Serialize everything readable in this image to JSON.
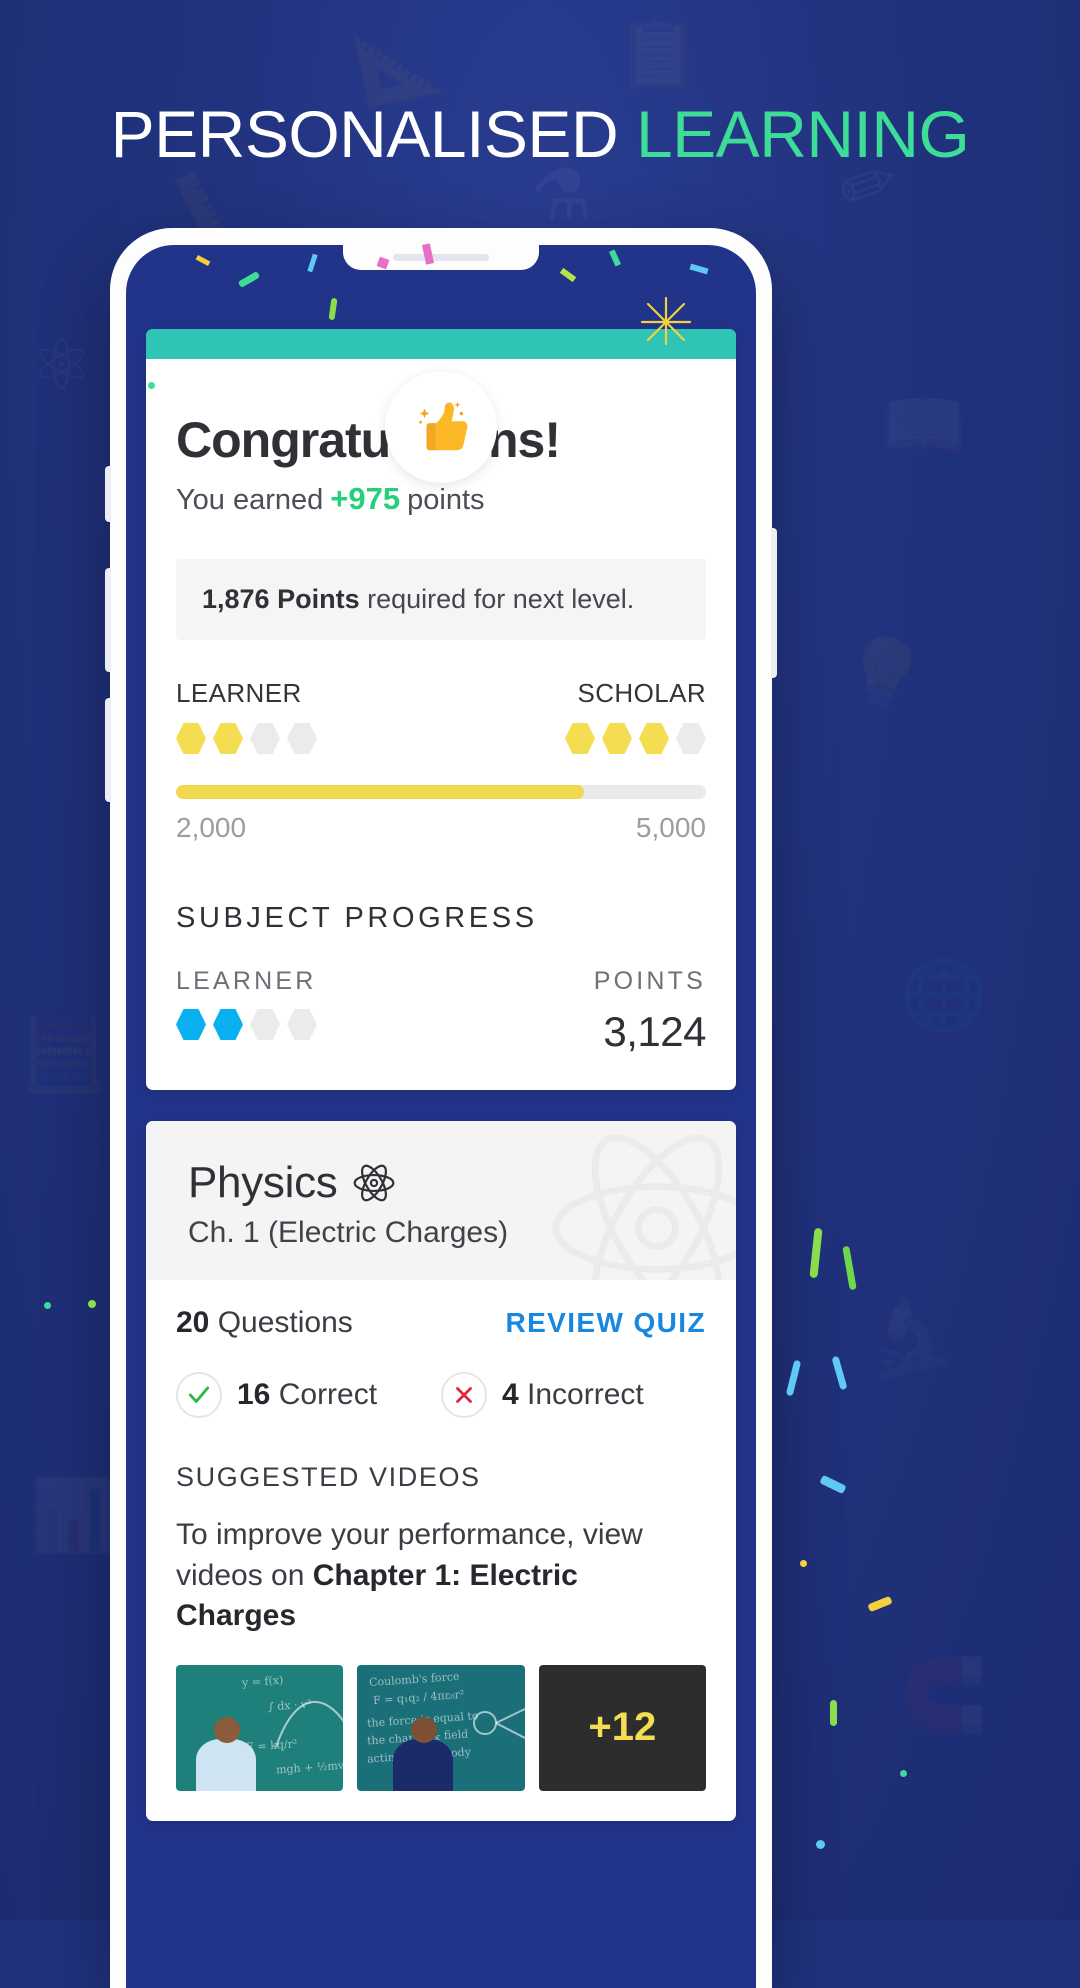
{
  "headline": {
    "word1": "PERSONALISED",
    "word2": "LEARNING",
    "color1": "#ffffff",
    "color2": "#3ddc97"
  },
  "theme": {
    "background": "#21327e",
    "teal_bar": "#2ec4b6",
    "accent_green": "#25d07d",
    "accent_yellow": "#f0d94f",
    "accent_blue": "#08b0ef",
    "link_blue": "#1887e0",
    "correct_green": "#2eb84a",
    "incorrect_red": "#e0283c"
  },
  "congrats_card": {
    "icon": "thumbs-up-icon",
    "title": "Congratulations!",
    "earned_prefix": "You earned",
    "earned_points": "+975",
    "earned_suffix": "points",
    "next_level": {
      "points": "1,876",
      "bold_word": "Points",
      "rest": "required for next level."
    },
    "tiers": [
      {
        "label": "LEARNER",
        "filled": 2,
        "total": 4,
        "color": "#f5dd52"
      },
      {
        "label": "SCHOLAR",
        "filled": 3,
        "total": 4,
        "color": "#f5dd52"
      }
    ],
    "progress": {
      "percent": 77,
      "min_label": "2,000",
      "max_label": "5,000"
    },
    "subject_progress": {
      "heading": "SUBJECT PROGRESS",
      "tier_label": "LEARNER",
      "tier_filled": 2,
      "tier_total": 4,
      "points_label": "POINTS",
      "points_value": "3,124"
    }
  },
  "physics_card": {
    "subject": "Physics",
    "subject_icon": "atom-icon",
    "chapter": "Ch. 1 (Electric Charges)",
    "questions_count": "20",
    "questions_word": "Questions",
    "review_link": "REVIEW QUIZ",
    "correct_count": "16",
    "correct_word": "Correct",
    "correct_icon": "check-icon",
    "incorrect_count": "4",
    "incorrect_word": "Incorrect",
    "incorrect_icon": "cross-icon",
    "suggested_heading": "SUGGESTED VIDEOS",
    "suggested_text_prefix": "To improve your performance, view videos on ",
    "suggested_text_bold": "Chapter 1: Electric Charges",
    "videos": [
      {
        "name": "video-thumbnail-1"
      },
      {
        "name": "video-thumbnail-2"
      },
      {
        "name": "video-thumbnail-3",
        "badge": "+12"
      }
    ]
  }
}
